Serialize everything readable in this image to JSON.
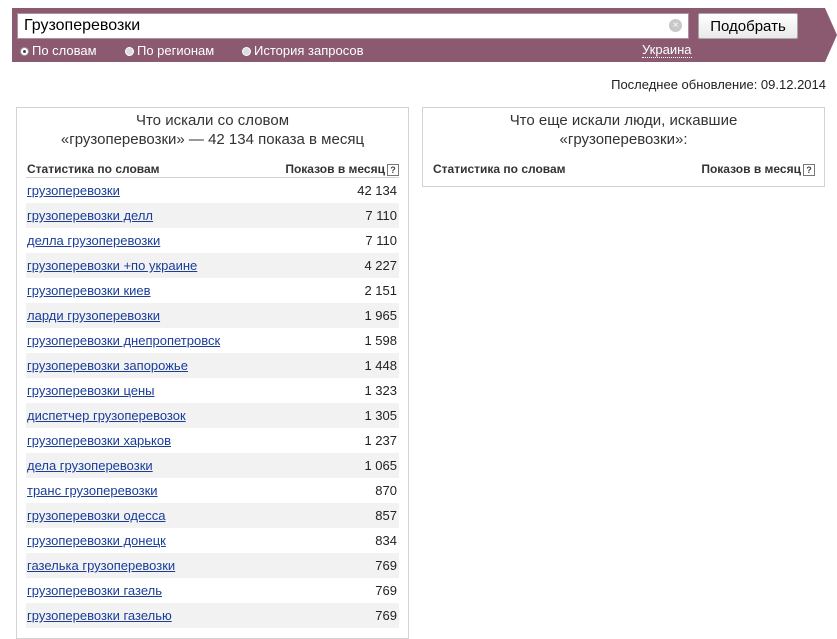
{
  "search": {
    "value": "Грузоперевозки",
    "submit_label": "Подобрать",
    "clear_symbol": "×"
  },
  "tabs": [
    {
      "label": "По словам",
      "selected": true
    },
    {
      "label": "По регионам",
      "selected": false
    },
    {
      "label": "История запросов",
      "selected": false
    }
  ],
  "region": "Украина",
  "last_update": "Последнее обновление: 09.12.2014",
  "left_panel": {
    "title_line1": "Что искали со словом",
    "title_line2": "«грузоперевозки» — 42 134 показа в месяц",
    "col_phrase": "Статистика по словам",
    "col_count": "Показов в месяц",
    "rows": [
      {
        "phrase": "грузоперевозки",
        "count": "42 134"
      },
      {
        "phrase": "грузоперевозки делл",
        "count": "7 110"
      },
      {
        "phrase": "делла грузоперевозки",
        "count": "7 110"
      },
      {
        "phrase": "грузоперевозки +по украине",
        "count": "4 227"
      },
      {
        "phrase": "грузоперевозки киев",
        "count": "2 151"
      },
      {
        "phrase": "ларди грузоперевозки",
        "count": "1 965"
      },
      {
        "phrase": "грузоперевозки днепропетровск",
        "count": "1 598"
      },
      {
        "phrase": "грузоперевозки запорожье",
        "count": "1 448"
      },
      {
        "phrase": "грузоперевозки цены",
        "count": "1 323"
      },
      {
        "phrase": "диспетчер грузоперевозок",
        "count": "1 305"
      },
      {
        "phrase": "грузоперевозки харьков",
        "count": "1 237"
      },
      {
        "phrase": "дела грузоперевозки",
        "count": "1 065"
      },
      {
        "phrase": "транс грузоперевозки",
        "count": "870"
      },
      {
        "phrase": "грузоперевозки одесса",
        "count": "857"
      },
      {
        "phrase": "грузоперевозки донецк",
        "count": "834"
      },
      {
        "phrase": "газелька грузоперевозки",
        "count": "769"
      },
      {
        "phrase": "грузоперевозки газель",
        "count": "769"
      },
      {
        "phrase": "грузоперевозки газелью",
        "count": "769"
      }
    ]
  },
  "right_panel": {
    "title_line1": "Что еще искали люди, искавшие",
    "title_line2": "«грузоперевозки»:",
    "col_phrase": "Статистика по словам",
    "col_count": "Показов в месяц"
  },
  "help_symbol": "?",
  "colors": {
    "topbar": "#8b5a71",
    "link": "#1a3d9a",
    "row_alt": "#f2f2f2"
  }
}
